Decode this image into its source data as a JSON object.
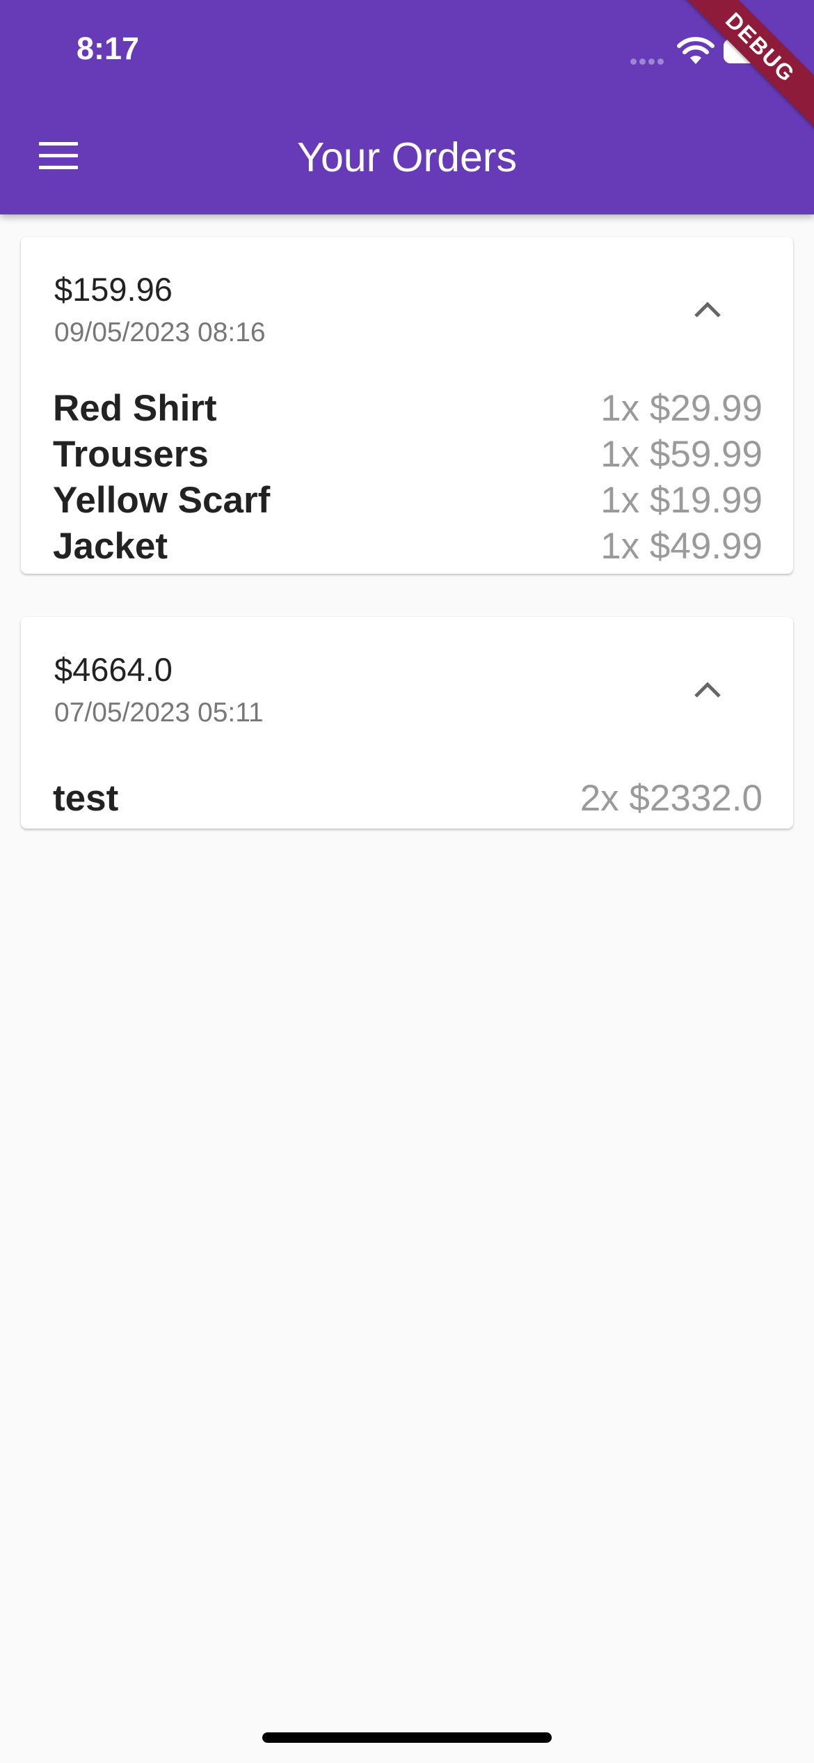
{
  "status_bar": {
    "time": "8:17"
  },
  "debug_banner": "DEBUG",
  "app_bar": {
    "title": "Your Orders",
    "menu_icon": "hamburger-menu-icon"
  },
  "orders": [
    {
      "total": "$159.96",
      "date": "09/05/2023 08:16",
      "expanded_icon": "chevron-up-icon",
      "items": [
        {
          "name": "Red Shirt",
          "qty_price": "1x $29.99"
        },
        {
          "name": "Trousers",
          "qty_price": "1x $59.99"
        },
        {
          "name": "Yellow Scarf",
          "qty_price": "1x $19.99"
        },
        {
          "name": "Jacket",
          "qty_price": "1x $49.99"
        }
      ]
    },
    {
      "total": "$4664.0",
      "date": "07/05/2023 05:11",
      "expanded_icon": "chevron-up-icon",
      "items": [
        {
          "name": "test",
          "qty_price": "2x $2332.0"
        }
      ]
    }
  ],
  "colors": {
    "app_bar": "#673ab7",
    "background": "#fafafa",
    "debug_banner": "#8e1b3a"
  }
}
